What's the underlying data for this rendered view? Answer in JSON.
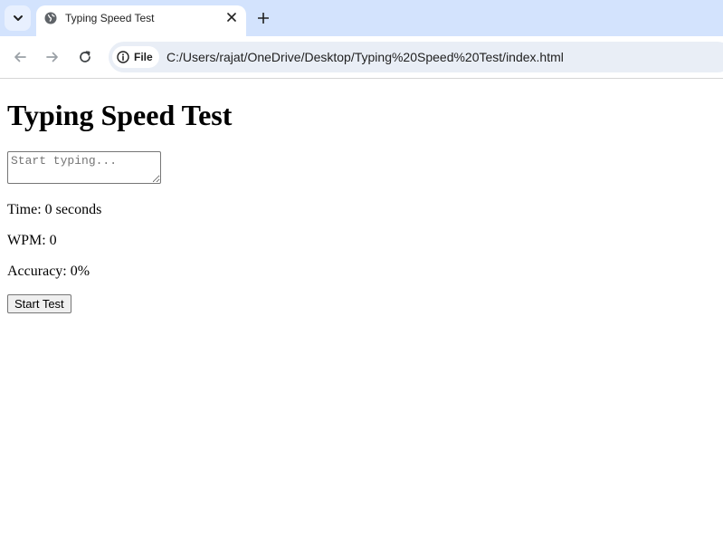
{
  "browser": {
    "tab": {
      "title": "Typing Speed Test"
    },
    "address_bar": {
      "chip_label": "File",
      "url": "C:/Users/rajat/OneDrive/Desktop/Typing%20Speed%20Test/index.html"
    },
    "icons": {
      "tab_search": "chevron-down-icon",
      "favicon": "globe-icon",
      "close": "close-icon",
      "new_tab": "plus-icon",
      "back": "arrow-left-icon",
      "forward": "arrow-right-icon",
      "reload": "reload-icon",
      "site_info": "info-icon"
    }
  },
  "page": {
    "heading": "Typing Speed Test",
    "input": {
      "placeholder": "Start typing...",
      "value": ""
    },
    "stats": {
      "time": "Time: 0 seconds",
      "wpm": "WPM: 0",
      "accuracy": "Accuracy: 0%"
    },
    "start_button_label": "Start Test"
  }
}
